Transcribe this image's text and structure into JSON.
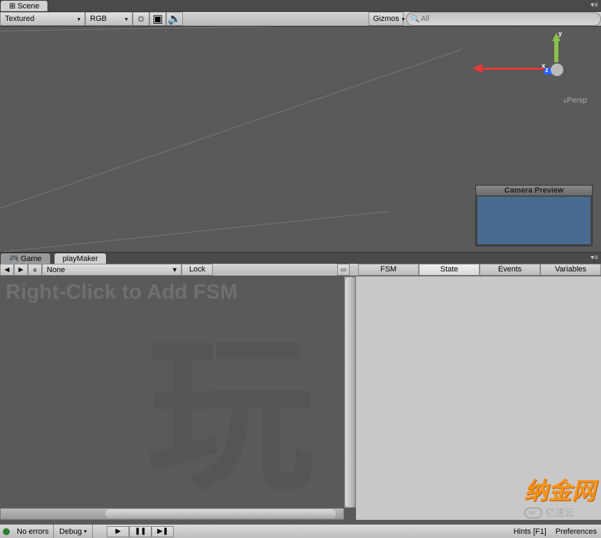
{
  "scene_tab": "Scene",
  "toolbar": {
    "shading": "Textured",
    "render_mode": "RGB",
    "gizmos": "Gizmos",
    "search_prefix": "All",
    "search_value": ""
  },
  "viewport": {
    "persp_label": "Persp",
    "camera_preview_title": "Camera Preview"
  },
  "lower_tabs": {
    "game": "Game",
    "playmaker": "playMaker"
  },
  "playmaker": {
    "nav_back": "◀",
    "nav_fwd": "▶",
    "nav_menu_label": "false",
    "menu": "None",
    "lock": "Lock",
    "tabs": {
      "fsm": "FSM",
      "state": "State",
      "events": "Events",
      "variables": "Variables"
    },
    "hint": "Right-Click to Add FSM"
  },
  "statusbar": {
    "errors": "No errors",
    "debug": "Debug",
    "hints": "Hints [F1]",
    "prefs": "Preferences"
  },
  "watermark": {
    "cn": "纳金网",
    "sub": "亿速云"
  }
}
